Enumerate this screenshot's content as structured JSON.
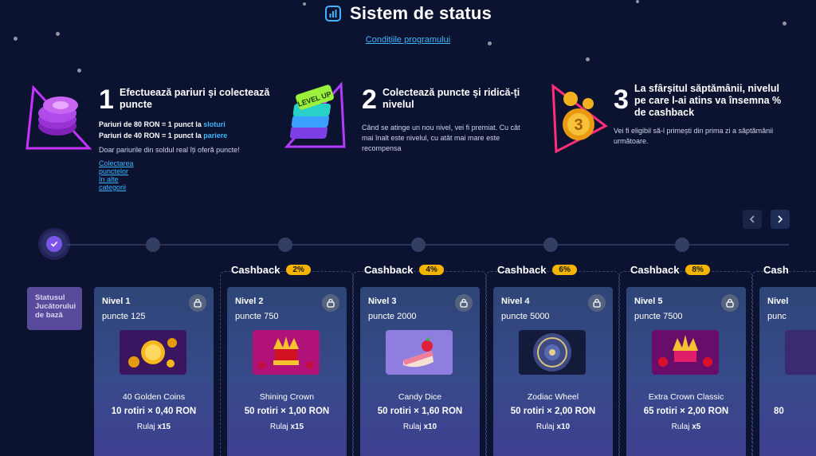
{
  "header": {
    "title": "Sistem de status",
    "conditions_link": "Condițiile programului"
  },
  "steps": [
    {
      "number": "1",
      "title": "Efectuează pariuri și colectează puncte",
      "line1_prefix": "Pariuri de 80 RON = 1 punct la ",
      "line1_highlight": "sloturi",
      "line2_prefix": "Pariuri de 40 RON = 1 punct la ",
      "line2_highlight": "pariere",
      "line3": "Doar pariurile din soldul real îți oferă puncte!",
      "link": "Colectarea punctelor în alte categorii",
      "image_icon": "purple-coins-icon"
    },
    {
      "number": "2",
      "title": "Colectează puncte și ridică-ți nivelul",
      "text": "Când se atinge un nou nivel, vei fi premiat. Cu cât mai înalt este nivelul, cu atât mai mare este recompensa",
      "image_icon": "level-up-blocks-icon",
      "image_text": "LEVEL UP"
    },
    {
      "number": "3",
      "title": "La sfârșitul săptămânii, nivelul pe care l-ai atins va însemna % de cashback",
      "text": "Vei fi eligibil să-l primești din prima zi a săptămânii următoare.",
      "image_icon": "gold-cashback-coin-icon"
    }
  ],
  "nav": {
    "prev_icon": "chevron-left-icon",
    "next_icon": "chevron-right-icon"
  },
  "basic_status": {
    "line1": "Statusul",
    "line2": "Jucătorului",
    "line3": "de bază"
  },
  "cashback_label": "Cashback",
  "levels": [
    {
      "level": "Nivel 1",
      "points": "puncte 125",
      "game": "40 Golden Coins",
      "spins": "10 rotiri × 0,40 RON",
      "wager_label": "Rulaj ",
      "wager_value": "x15",
      "cashback": ""
    },
    {
      "level": "Nivel 2",
      "points": "puncte 750",
      "game": "Shining Crown",
      "spins": "50 rotiri × 1,00 RON",
      "wager_label": "Rulaj ",
      "wager_value": "x15",
      "cashback": "2%"
    },
    {
      "level": "Nivel 3",
      "points": "puncte 2000",
      "game": "Candy Dice",
      "spins": "50 rotiri × 1,60 RON",
      "wager_label": "Rulaj ",
      "wager_value": "x10",
      "cashback": "4%"
    },
    {
      "level": "Nivel 4",
      "points": "puncte 5000",
      "game": "Zodiac Wheel",
      "spins": "50 rotiri × 2,00 RON",
      "wager_label": "Rulaj ",
      "wager_value": "x10",
      "cashback": "6%"
    },
    {
      "level": "Nivel 5",
      "points": "puncte 7500",
      "game": "Extra Crown Classic",
      "spins": "65 rotiri × 2,00 RON",
      "wager_label": "Rulaj ",
      "wager_value": "x5",
      "cashback": "8%"
    }
  ],
  "partial_next": {
    "cashback_label": "Cash",
    "level": "Nivel",
    "points": "punc",
    "spins": "80 "
  },
  "colors": {
    "background": "#0c1330",
    "accent_link": "#3fb6ff",
    "cashback_badge": "#f5b400",
    "check_purple": "#7b55e8"
  }
}
